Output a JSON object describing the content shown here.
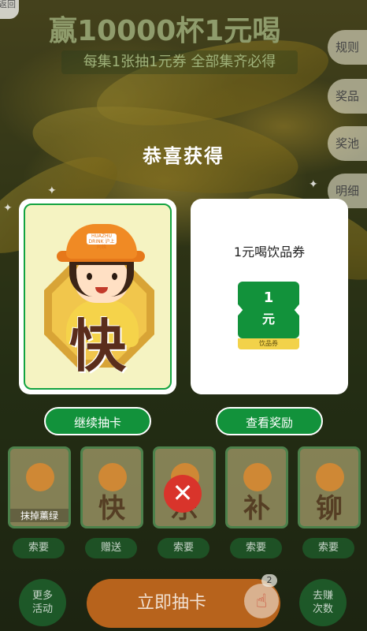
{
  "header": {
    "back_label": "返回",
    "title": "赢10000杯1元喝",
    "subtitle": "每集1张抽1元券 全部集齐必得"
  },
  "side_menu": [
    {
      "label": "规则"
    },
    {
      "label": "奖品"
    },
    {
      "label": "奖池"
    },
    {
      "label": "明细"
    }
  ],
  "modal": {
    "heading": "恭喜获得",
    "card": {
      "character": "快",
      "hat_label": "HUAZHU DRINK 沪上阿姨"
    },
    "prize": {
      "title": "1元喝饮品券",
      "coupon_value": "1",
      "coupon_unit": "元",
      "coupon_caption": "饮品券"
    },
    "continue_button": "继续抽卡",
    "view_button": "查看奖励"
  },
  "card_row": [
    {
      "character": "",
      "label": "抹掉薰绿",
      "action": "索要"
    },
    {
      "character": "快",
      "label": "",
      "action": "赠送"
    },
    {
      "character": "乐",
      "label": "",
      "action": "索要"
    },
    {
      "character": "补",
      "label": "",
      "action": "索要"
    },
    {
      "character": "铆",
      "label": "",
      "action": "索要"
    }
  ],
  "bottom_bar": {
    "more_line1": "更多",
    "more_line2": "活动",
    "draw_label": "立即抽卡",
    "draw_count": "2",
    "earn_line1": "去赚",
    "earn_line2": "次数"
  },
  "colors": {
    "brand_green": "#12923b",
    "accent_orange": "#f08a24",
    "coupon_yellow": "#f2d24a",
    "close_red": "#d9342b"
  },
  "icons": {
    "close": "close-icon",
    "hand": "pointing-hand-icon",
    "sparkle": "sparkle-icon"
  }
}
